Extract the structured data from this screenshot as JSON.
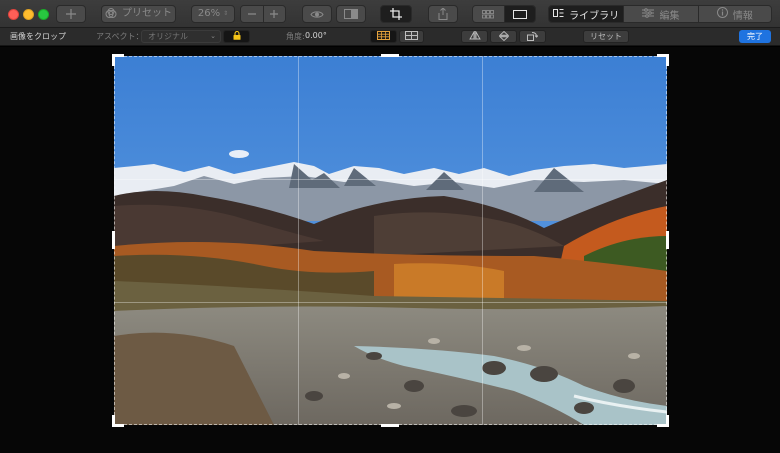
{
  "toolbar": {
    "add_icon": "plus-icon",
    "preset_label": "プリセット",
    "zoom_value": "26%",
    "tabs": [
      {
        "label": "ライブラリ",
        "icon": "library-icon"
      },
      {
        "label": "編集",
        "icon": "sliders-icon"
      },
      {
        "label": "情報",
        "icon": "info-icon"
      }
    ]
  },
  "cropbar": {
    "title": "画像をクロップ",
    "aspect_label": "アスペクト：",
    "aspect_value": "オリジナル",
    "angle_label": "角度:",
    "angle_value": "0.00°",
    "reset_label": "リセット",
    "done_label": "完了"
  },
  "colors": {
    "accent": "#1f73e0",
    "toolbar_bg": "#3a3a3a",
    "canvas_bg": "#060606",
    "lock_yellow": "#f5c518"
  }
}
